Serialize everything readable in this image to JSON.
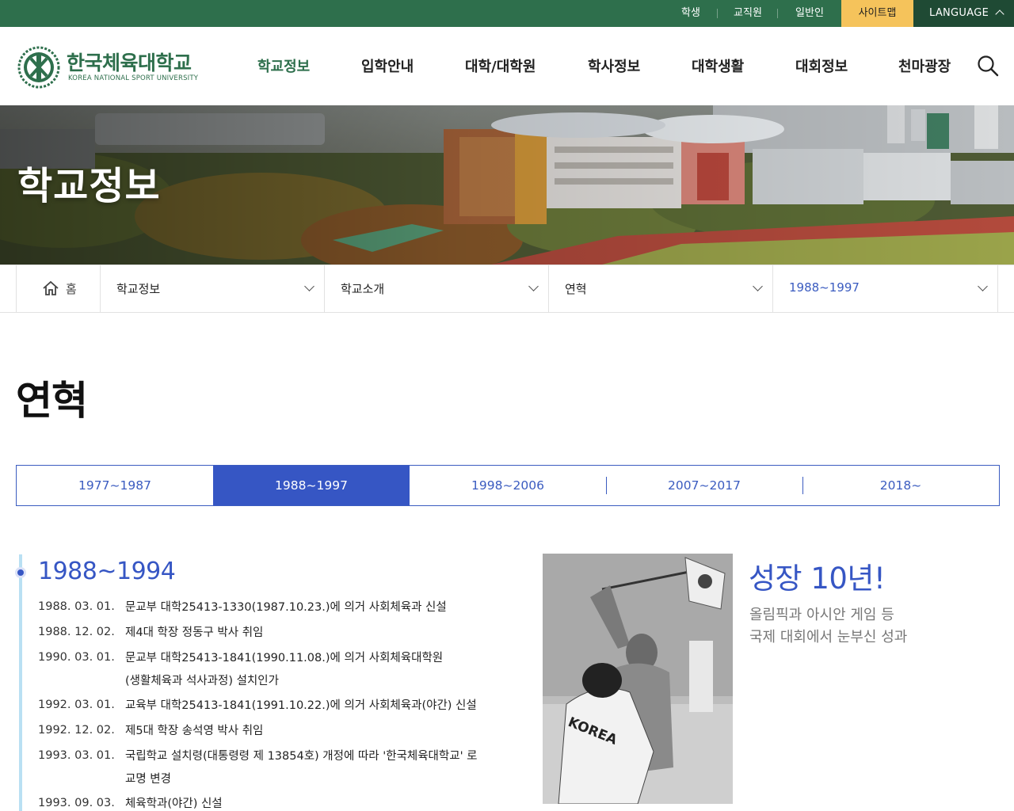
{
  "utility_bar": {
    "student": "학생",
    "staff": "교직원",
    "public": "일반인",
    "sitemap": "사이트맵",
    "language": "LANGUAGE"
  },
  "logo": {
    "name_ko": "한국체육대학교",
    "name_en": "KOREA NATIONAL SPORT UNIVERSITY"
  },
  "gnb": {
    "items": [
      "학교정보",
      "입학안내",
      "대학/대학원",
      "학사정보",
      "대학생활",
      "대회정보",
      "천마광장"
    ],
    "active_index": 0
  },
  "hero": {
    "title": "학교정보"
  },
  "breadcrumb": {
    "home": "홈",
    "level1": "학교정보",
    "level2": "학교소개",
    "level3": "연혁",
    "level4": "1988~1997"
  },
  "page_title": "연혁",
  "era_tabs": {
    "items": [
      "1977~1987",
      "1988~1997",
      "1998~2006",
      "2007~2017",
      "2018~"
    ],
    "active_index": 1
  },
  "timeline": {
    "period": "1988~1994",
    "events": [
      {
        "date": "1988. 03. 01.",
        "lines": [
          "문교부 대학25413-1330(1987.10.23.)에 의거 사회체육과 신설"
        ]
      },
      {
        "date": "1988. 12. 02.",
        "lines": [
          "제4대 학장 정동구 박사 취임"
        ]
      },
      {
        "date": "1990. 03. 01.",
        "lines": [
          "문교부 대학25413-1841(1990.11.08.)에 의거 사회체육대학원",
          "(생활체육과 석사과정) 설치인가"
        ]
      },
      {
        "date": "1992. 03. 01.",
        "lines": [
          "교육부 대학25413-1841(1991.10.22.)에 의거 사회체육과(야간) 신설"
        ]
      },
      {
        "date": "1992. 12. 02.",
        "lines": [
          "제5대 학장 송석영 박사 취임"
        ]
      },
      {
        "date": "1993. 03. 01.",
        "lines": [
          "국립학교 설치령(대통령령 제 13854호) 개정에 따라 '한국체육대학교' 로",
          "교명 변경"
        ]
      },
      {
        "date": "1993. 09. 03.",
        "lines": [
          "체육학과(야간) 신설"
        ]
      }
    ]
  },
  "highlight": {
    "title": "성장 10년!",
    "lines": [
      "올림픽과 아시안 게임 등",
      "국제 대회에서 눈부신 성과"
    ],
    "photo_text": "KOREA"
  },
  "colors": {
    "brand_green": "#2e6f4c",
    "sitemap_yellow": "#f5c35b",
    "accent_blue": "#3656c4",
    "timeline_line": "#b9e0f3"
  }
}
